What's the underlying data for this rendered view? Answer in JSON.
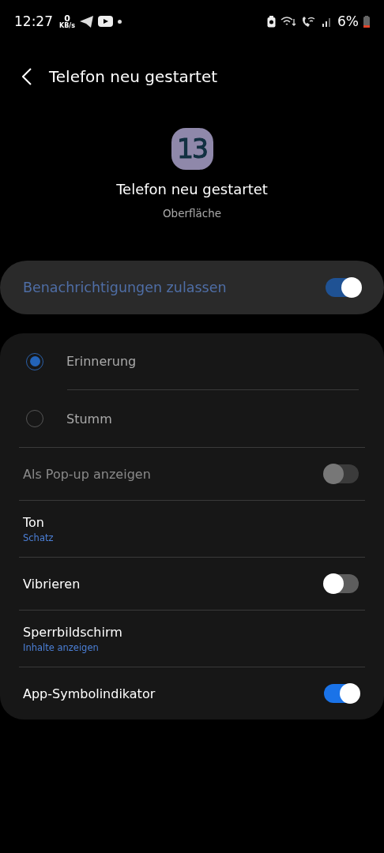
{
  "status_bar": {
    "time": "12:27",
    "net_speed": "0",
    "net_unit": "KB/s",
    "battery": "6%"
  },
  "header": {
    "title": "Telefon neu gestartet"
  },
  "app": {
    "icon_text": "13",
    "title": "Telefon neu gestartet",
    "subtitle": "Oberfläche"
  },
  "master": {
    "label": "Benachrichtigungen zulassen",
    "on": true
  },
  "settings": [
    {
      "kind": "radio",
      "label": "Erinnerung",
      "selected": true
    },
    {
      "kind": "radio",
      "label": "Stumm",
      "selected": false
    },
    {
      "kind": "switch",
      "label": "Als Pop-up anzeigen",
      "on": false,
      "disabled": true
    },
    {
      "kind": "value",
      "label": "Ton",
      "value": "Schatz"
    },
    {
      "kind": "switch",
      "label": "Vibrieren",
      "on": false,
      "disabled": false
    },
    {
      "kind": "value",
      "label": "Sperrbildschirm",
      "value": "Inhalte anzeigen"
    },
    {
      "kind": "switch",
      "label": "App-Symbolindikator",
      "on": true,
      "disabled": false
    }
  ]
}
